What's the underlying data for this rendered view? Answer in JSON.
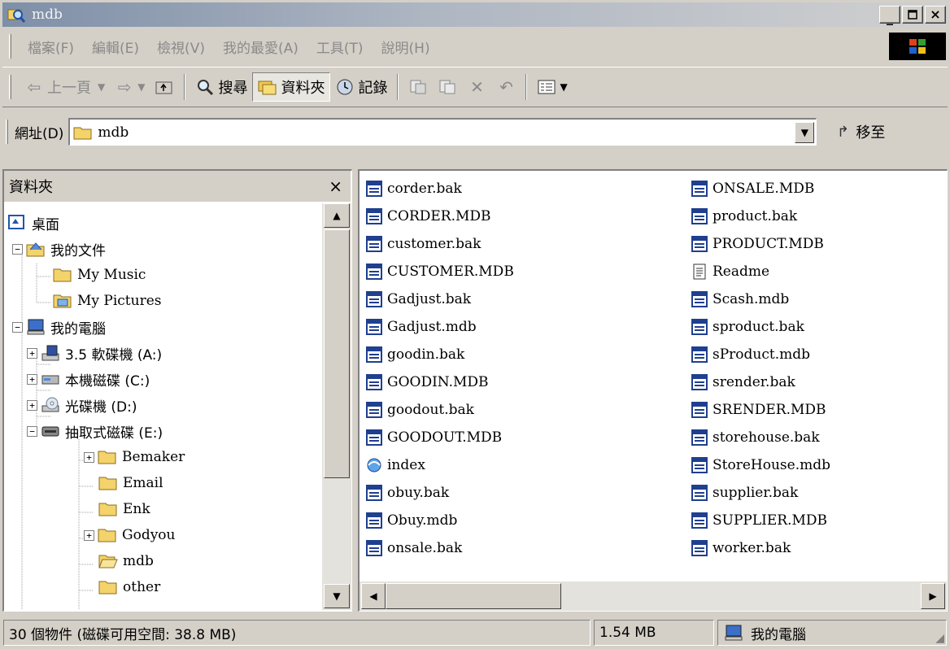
{
  "window": {
    "title": "mdb"
  },
  "menu": [
    "檔案(F)",
    "編輯(E)",
    "檢視(V)",
    "我的最愛(A)",
    "工具(T)",
    "說明(H)"
  ],
  "toolbar": {
    "back": "上一頁",
    "search": "搜尋",
    "folders": "資料夾",
    "history": "記錄"
  },
  "address": {
    "label": "網址(D)",
    "value": "mdb",
    "go": "移至"
  },
  "folder_pane": {
    "title": "資料夾",
    "tree": [
      {
        "label": "桌面"
      },
      {
        "label": "我的文件"
      },
      {
        "label": "My Music"
      },
      {
        "label": "My Pictures"
      },
      {
        "label": "我的電腦"
      },
      {
        "label": "3.5 軟碟機 (A:)"
      },
      {
        "label": "本機磁碟 (C:)"
      },
      {
        "label": "光碟機 (D:)"
      },
      {
        "label": "抽取式磁碟 (E:)"
      },
      {
        "label": "Bemaker"
      },
      {
        "label": "Email"
      },
      {
        "label": "Enk"
      },
      {
        "label": "Godyou"
      },
      {
        "label": "mdb"
      },
      {
        "label": "other"
      }
    ]
  },
  "files": {
    "column1": [
      {
        "name": "corder.bak",
        "icon": "access-db-icon"
      },
      {
        "name": "CORDER.MDB",
        "icon": "access-db-icon"
      },
      {
        "name": "customer.bak",
        "icon": "access-db-icon"
      },
      {
        "name": "CUSTOMER.MDB",
        "icon": "access-db-icon"
      },
      {
        "name": "Gadjust.bak",
        "icon": "access-db-icon"
      },
      {
        "name": "Gadjust.mdb",
        "icon": "access-db-icon"
      },
      {
        "name": "goodin.bak",
        "icon": "access-db-icon"
      },
      {
        "name": "GOODIN.MDB",
        "icon": "access-db-icon"
      },
      {
        "name": "goodout.bak",
        "icon": "access-db-icon"
      },
      {
        "name": "GOODOUT.MDB",
        "icon": "access-db-icon"
      },
      {
        "name": "index",
        "icon": "html-icon"
      },
      {
        "name": "obuy.bak",
        "icon": "access-db-icon"
      },
      {
        "name": "Obuy.mdb",
        "icon": "access-db-icon"
      },
      {
        "name": "onsale.bak",
        "icon": "access-db-icon"
      }
    ],
    "column2": [
      {
        "name": "ONSALE.MDB",
        "icon": "access-db-icon"
      },
      {
        "name": "product.bak",
        "icon": "access-db-icon"
      },
      {
        "name": "PRODUCT.MDB",
        "icon": "access-db-icon"
      },
      {
        "name": "Readme",
        "icon": "text-document-icon"
      },
      {
        "name": "Scash.mdb",
        "icon": "access-db-icon"
      },
      {
        "name": "sproduct.bak",
        "icon": "access-db-icon"
      },
      {
        "name": "sProduct.mdb",
        "icon": "access-db-icon"
      },
      {
        "name": "srender.bak",
        "icon": "access-db-icon"
      },
      {
        "name": "SRENDER.MDB",
        "icon": "access-db-icon"
      },
      {
        "name": "storehouse.bak",
        "icon": "access-db-icon"
      },
      {
        "name": "StoreHouse.mdb",
        "icon": "access-db-icon"
      },
      {
        "name": "supplier.bak",
        "icon": "access-db-icon"
      },
      {
        "name": "SUPPLIER.MDB",
        "icon": "access-db-icon"
      },
      {
        "name": "worker.bak",
        "icon": "access-db-icon"
      }
    ]
  },
  "status": {
    "objects": "30 個物件 (磁碟可用空間: 38.8 MB)",
    "size": "1.54 MB",
    "location": "我的電腦"
  },
  "colors": {
    "title_start": "#7e8fa8",
    "title_end": "#d0d0d0",
    "face": "#d4d0c8"
  }
}
